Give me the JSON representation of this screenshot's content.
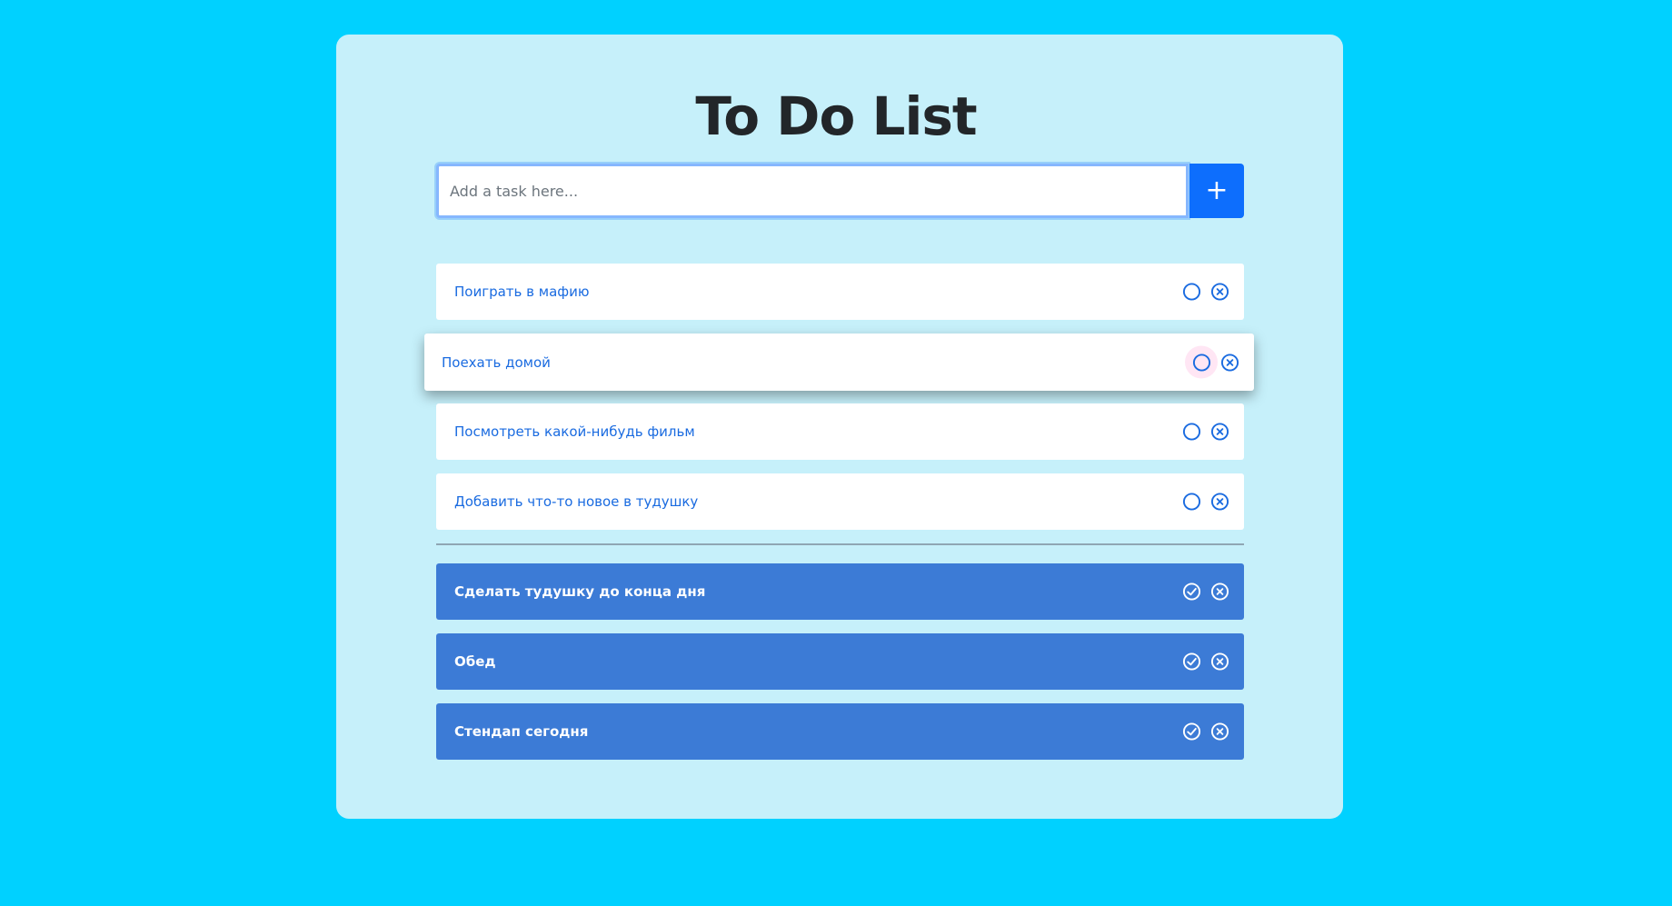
{
  "app": {
    "title": "To Do List"
  },
  "input": {
    "placeholder": "Add a task here...",
    "value": "",
    "add_label": "+"
  },
  "tasks": [
    {
      "text": "Поиграть в мафию",
      "done": false
    },
    {
      "text": "Поехать домой",
      "done": false,
      "dragging": true
    },
    {
      "text": "Посмотреть какой-нибудь фильм",
      "done": false
    },
    {
      "text": "Добавить что-то новое в тудушку",
      "done": false
    }
  ],
  "completed": [
    {
      "text": "Сделать тудушку до конца дня",
      "done": true
    },
    {
      "text": "Обед",
      "done": true
    },
    {
      "text": "Стендап сегодня",
      "done": true
    }
  ],
  "colors": {
    "page_background": "#00d1ff",
    "panel_background": "#c6f0fa",
    "accent": "#0d6efd",
    "todo_text": "#1a6be0",
    "done_background": "#3c7bd6"
  },
  "icons": {
    "complete_toggle": "circle-icon",
    "completed_toggle": "check-circle-icon",
    "delete": "x-circle-icon"
  }
}
